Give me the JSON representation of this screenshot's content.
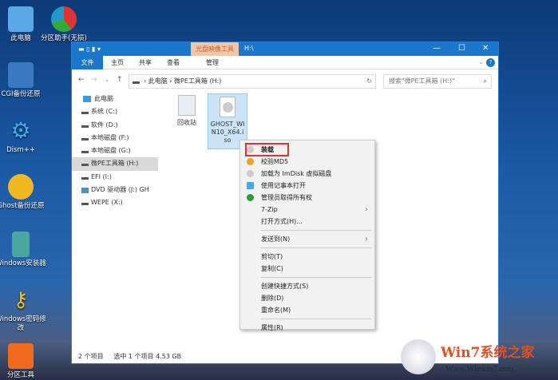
{
  "desktop": {
    "icons": [
      {
        "label": "此电脑"
      },
      {
        "label": "分区助手(无损)"
      },
      {
        "label": "CGI备份还原"
      },
      {
        "label": "Dism++"
      },
      {
        "label": "Ghost备份还原"
      },
      {
        "label": "Windows安装器"
      },
      {
        "label": "Windows密码修改"
      },
      {
        "label": "分区工具"
      }
    ]
  },
  "window": {
    "title": "H:\\",
    "context_tab": "光盘映像工具",
    "ribbon": {
      "tabs": [
        "文件",
        "主页",
        "共享",
        "查看",
        "管理"
      ]
    },
    "address": {
      "path": [
        "此电脑",
        "微PE工具箱 (H:)"
      ],
      "search_placeholder": "搜索\"微PE工具箱 (H:)\""
    },
    "nav": {
      "items": [
        "此电脑",
        "系统 (C:)",
        "软件 (D:)",
        "本地磁盘 (F:)",
        "本地磁盘 (G:)",
        "微PE工具箱 (H:)",
        "EFI (I:)",
        "DVD 驱动器 (J:) GH",
        "WEPE (X:)"
      ]
    },
    "files": [
      {
        "name": "回收站"
      },
      {
        "name": "GHOST_WIN10_X64.iso"
      }
    ],
    "status": {
      "count": "2 个项目",
      "selected": "选中 1 个项目  4.53 GB"
    }
  },
  "context_menu": {
    "items": [
      "装载",
      "校验MD5",
      "加载为 ImDisk 虚拟磁盘",
      "使用记事本打开",
      "管理员取得所有权",
      "7-Zip",
      "打开方式(H)...",
      "发送到(N)",
      "剪切(T)",
      "复制(C)",
      "创建快捷方式(S)",
      "删除(D)",
      "重命名(M)",
      "属性(R)"
    ]
  },
  "watermark": {
    "brand": "Win7系统之家",
    "url": "Www.Winwin7.com"
  }
}
